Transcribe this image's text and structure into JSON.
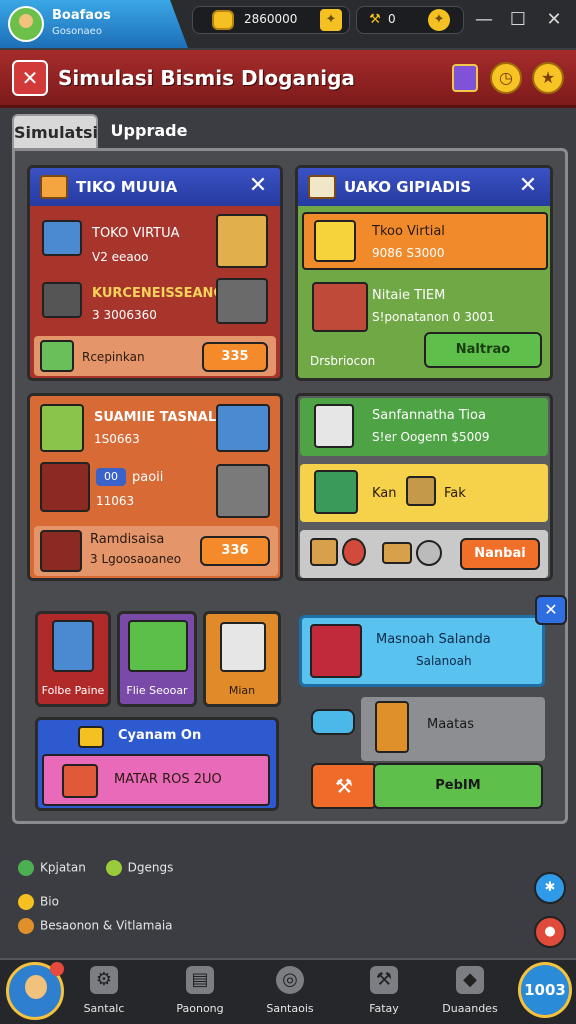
{
  "topbar": {
    "profile_name": "Boafaos",
    "profile_sub": "Gosonaeo",
    "coins": "2860000",
    "gems": "0",
    "win_min": "—",
    "win_max": "☐",
    "win_close": "✕"
  },
  "title": {
    "text": "Simulasi Bismis Dloganiga",
    "icon": "✕"
  },
  "tabs": [
    "Simulatsi",
    "Upprade"
  ],
  "card1": {
    "title": "TIKO MUUIA",
    "row1_name": "TOKO VIRTUA",
    "row1_sub": "V2 eeaoo",
    "row2_name": "KURCENEISSEANG",
    "row2_sub": "3 3006360",
    "footer_label": "Rcepinkan",
    "footer_btn": "335"
  },
  "card2": {
    "title": "UAKO GIPIADIS",
    "row1_name": "Tkoo Virtial",
    "row1_sub": "9086 S3000",
    "row2_name": "Nitaie TIEM",
    "row2_sub": "S!ponatanon 0 3001",
    "footer_label": "Drsbriocon",
    "footer_btn": "Naltrao"
  },
  "card3": {
    "name": "SUAMIIE TASNAL",
    "sub": "1S0663",
    "mid_label": "paoii",
    "mid_badge": "00",
    "mid_sub": "11063",
    "footer_label": "Ramdisaisa",
    "footer_sub": "3 Lgoosaoaneo",
    "footer_btn": "336"
  },
  "card4": {
    "row1_name": "Sanfannatha Tioa",
    "row1_sub": "S!er Oogenn $5009",
    "row2_a": "Kan",
    "row2_b": "Fak",
    "footer_btn": "Nanbai"
  },
  "small_tiles": [
    "Folbe Paine",
    "Flie Seooar",
    "Mian"
  ],
  "promo": {
    "title": "Cyanam On",
    "btn": "MATAR ROS 2UO"
  },
  "message": {
    "line1": "Masnoah Salanda",
    "line2": "Salanoah",
    "close": "✕"
  },
  "side_item": {
    "label": "Maatas",
    "btn": "PebIM"
  },
  "status": {
    "a": "Kpjatan",
    "b": "Dgengs",
    "c": "Bio",
    "d": "Besaonon & Vitlamaia"
  },
  "bottom_nav": [
    "Santalc",
    "Paonong",
    "Santaois",
    "Fatay",
    "Duaandes"
  ],
  "speed_label": "1003"
}
